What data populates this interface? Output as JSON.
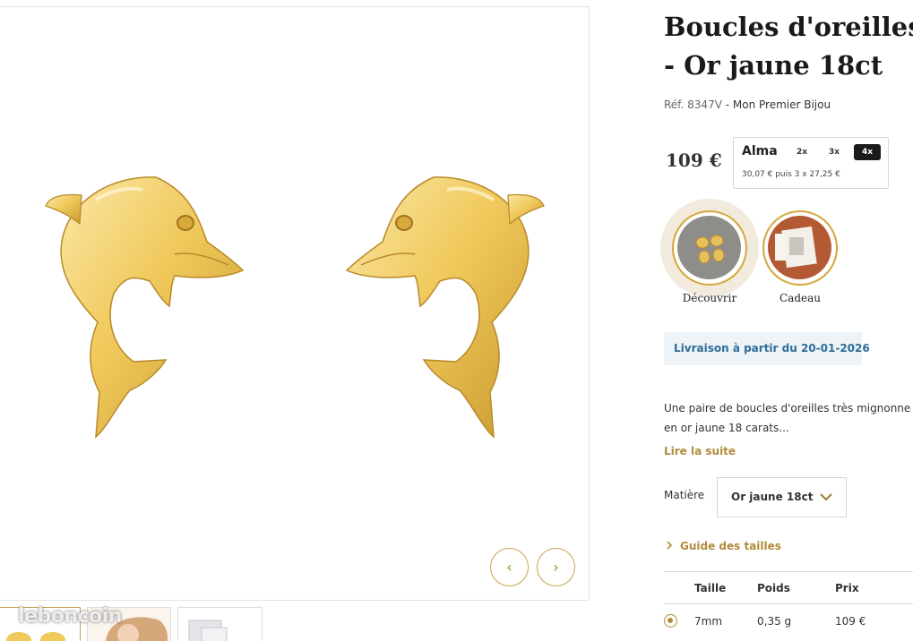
{
  "product": {
    "title_line1": "Boucles d'oreilles",
    "title_line1_cut": "d",
    "title_line2": "- Or jaune 18ct",
    "ref_label": "Réf. 8347V",
    "ref_sep": " - ",
    "brand": "Mon Premier Bijou",
    "price": "109 €"
  },
  "alma": {
    "logo": "Alma",
    "options": [
      "2x",
      "3x",
      "4x"
    ],
    "selected": "4x",
    "detail": "30,07 € puis 3 x 27,25 €"
  },
  "occasions": [
    {
      "label": "Découvrir",
      "selected": true
    },
    {
      "label": "Cadeau",
      "selected": false
    }
  ],
  "delivery": "Livraison à partir du 20-01-2026",
  "description": {
    "line1": "Une paire de boucles d'oreilles très mignonne",
    "line2": "en or jaune 18 carats..."
  },
  "read_more": "Lire la suite",
  "matiere": {
    "label": "Matière",
    "value": "Or jaune 18ct"
  },
  "size_guide": "Guide des tailles",
  "sizes_table": {
    "headers": [
      "Taille",
      "Poids",
      "Prix"
    ],
    "rows": [
      {
        "taille": "7mm",
        "poids": "0,35 g",
        "prix": "109 €",
        "selected": true
      }
    ]
  },
  "gallery": {
    "prev_glyph": "‹",
    "next_glyph": "›"
  },
  "watermark": "leboncoin",
  "colors": {
    "gold_accent": "#b18b3a",
    "gold_ring": "#d4a73a",
    "delivery_bg": "#eef3f8",
    "delivery_text": "#2f6e98"
  }
}
